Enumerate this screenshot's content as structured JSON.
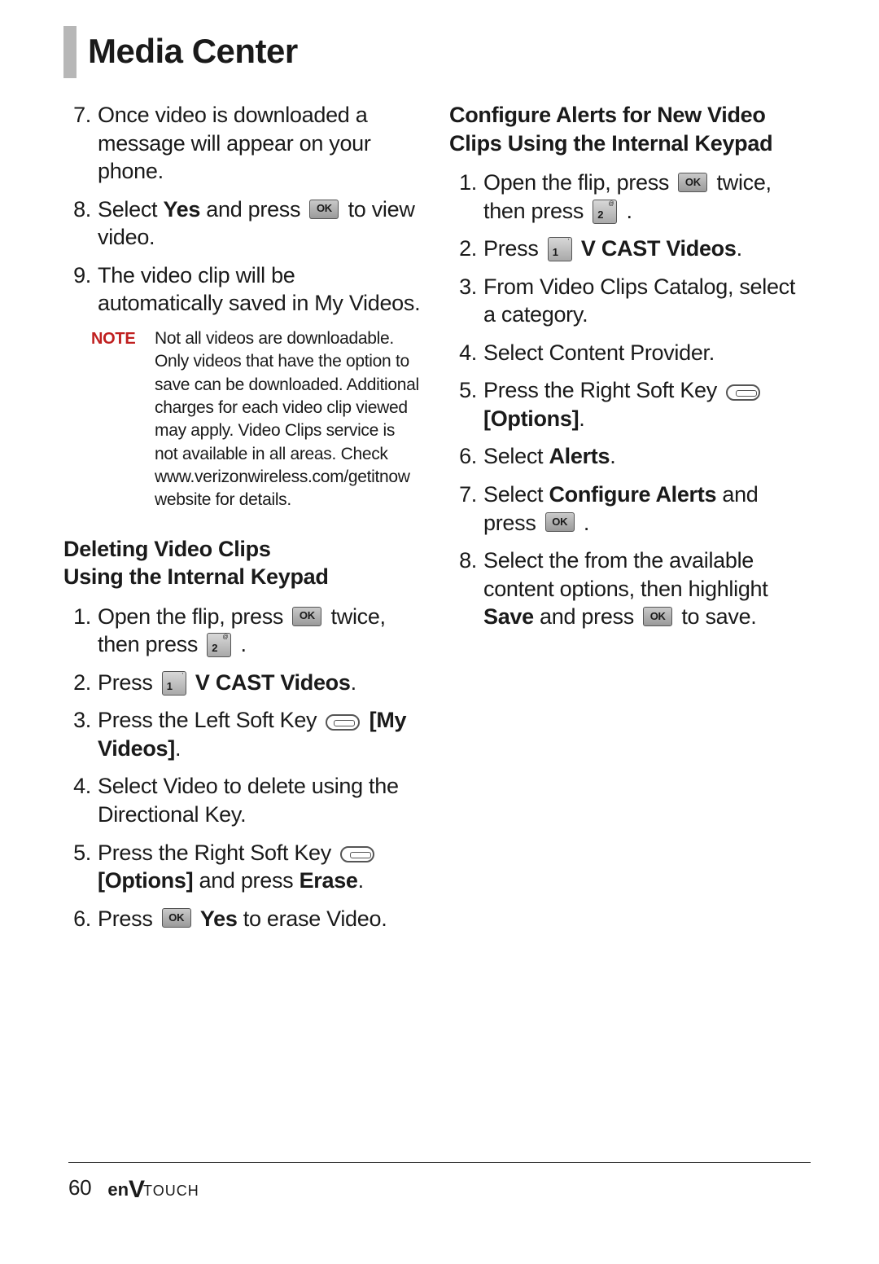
{
  "title": "Media Center",
  "col1": {
    "items_a": [
      {
        "n": "7.",
        "parts": [
          "Once video is downloaded a message will appear on your phone."
        ]
      },
      {
        "n": "8.",
        "parts": [
          "Select ",
          {
            "b": "Yes"
          },
          " and press ",
          {
            "icon": "ok"
          },
          " to view video."
        ]
      },
      {
        "n": "9.",
        "parts": [
          "The video clip will be automatically saved in My Videos."
        ]
      }
    ],
    "note_label": "NOTE",
    "note": "Not all videos are downloadable. Only videos that have the option to save can be downloaded. Additional charges for each video clip viewed may apply. Video Clips service is not available in all areas. Check www.verizonwireless.com/getitnow website for details.",
    "subhead_b": "Deleting Video Clips\nUsing the Internal Keypad",
    "items_b": [
      {
        "n": "1.",
        "parts": [
          "Open the flip, press ",
          {
            "icon": "ok"
          },
          " twice, then press ",
          {
            "icon": "num2"
          },
          " ."
        ]
      },
      {
        "n": "2.",
        "parts": [
          "Press ",
          {
            "icon": "num1"
          },
          " ",
          {
            "b": "V CAST Videos"
          },
          "."
        ]
      },
      {
        "n": "3.",
        "parts": [
          "Press the Left Soft Key ",
          {
            "icon": "softL"
          },
          " ",
          {
            "b": "[My Videos]"
          },
          "."
        ]
      },
      {
        "n": "4.",
        "parts": [
          "Select Video to delete using the Directional Key."
        ]
      },
      {
        "n": "5.",
        "parts": [
          "Press the Right Soft Key ",
          {
            "icon": "softR"
          },
          " ",
          {
            "b": "[Options]"
          },
          " and press ",
          {
            "b": "Erase"
          },
          "."
        ]
      },
      {
        "n": "6.",
        "parts": [
          "Press ",
          {
            "icon": "ok"
          },
          " ",
          {
            "b": "Yes"
          },
          " to erase Video."
        ]
      }
    ]
  },
  "col2": {
    "subhead": "Configure Alerts for New Video Clips Using the Internal Keypad",
    "items": [
      {
        "n": "1.",
        "parts": [
          "Open the flip, press ",
          {
            "icon": "ok"
          },
          " twice, then press ",
          {
            "icon": "num2"
          },
          " ."
        ]
      },
      {
        "n": "2.",
        "parts": [
          "Press ",
          {
            "icon": "num1"
          },
          " ",
          {
            "b": "V CAST Videos"
          },
          "."
        ]
      },
      {
        "n": "3.",
        "parts": [
          "From Video Clips Catalog, select a category."
        ]
      },
      {
        "n": "4.",
        "parts": [
          "Select Content Provider."
        ]
      },
      {
        "n": "5.",
        "parts": [
          "Press the Right Soft Key ",
          {
            "icon": "softR"
          },
          " ",
          {
            "b": "[Options]"
          },
          "."
        ]
      },
      {
        "n": "6.",
        "parts": [
          "Select ",
          {
            "b": "Alerts"
          },
          "."
        ]
      },
      {
        "n": "7.",
        "parts": [
          "Select ",
          {
            "b": "Configure Alerts"
          },
          " and press ",
          {
            "icon": "ok"
          },
          " ."
        ]
      },
      {
        "n": "8.",
        "parts": [
          "Select the from the available content options, then highlight ",
          {
            "b": "Save"
          },
          " and press ",
          {
            "icon": "ok"
          },
          " to save."
        ]
      }
    ]
  },
  "footer": {
    "page": "60",
    "brand_en": "en",
    "brand_v": "V",
    "brand_touch": "TOUCH"
  },
  "icon_ok": "OK"
}
